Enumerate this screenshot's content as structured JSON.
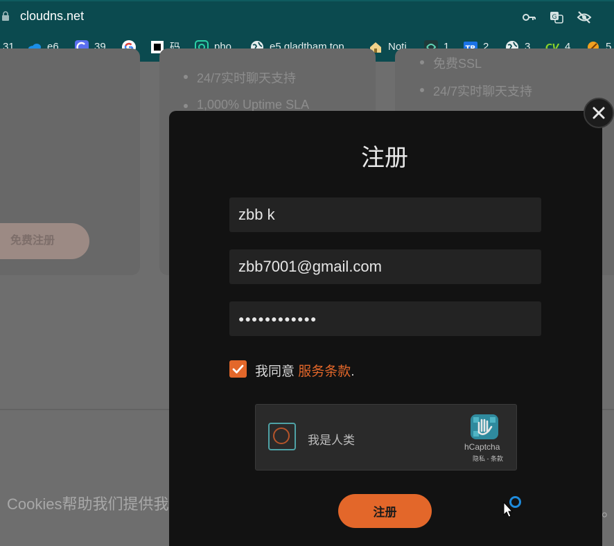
{
  "browser": {
    "url": "cloudns.net",
    "toolbar_icons": [
      "key-icon",
      "translate-icon",
      "eye-off-icon"
    ],
    "bookmarks": [
      {
        "label": "31",
        "icon": "calendar-icon"
      },
      {
        "label": "e6",
        "icon": "onedrive-icon"
      },
      {
        "label": "39",
        "icon": "c-logo-icon"
      },
      {
        "label": "",
        "icon": "google-icon"
      },
      {
        "label": "码",
        "icon": "square-logo-icon"
      },
      {
        "label": "pho",
        "icon": "pho-logo-icon"
      },
      {
        "label": "e5.gladtbam.top",
        "icon": "globe-icon"
      },
      {
        "label": "Noti",
        "icon": "notion-home-icon"
      },
      {
        "label": "1",
        "icon": "app-logo-icon"
      },
      {
        "label": "2",
        "icon": "tp-logo-icon"
      },
      {
        "label": "3",
        "icon": "globe-icon"
      },
      {
        "label": "4",
        "icon": "cv-logo-icon"
      },
      {
        "label": "5",
        "icon": "orange-circle-icon"
      }
    ],
    "bookmark_tp": "TP",
    "bookmark_cv": "CV"
  },
  "background": {
    "features_left": [
      "24/7实时聊天支持",
      "1,000% Uptime SLA"
    ],
    "features_right": [
      "免费SSL",
      "24/7实时聊天支持"
    ],
    "free_signup_button": "免费注册",
    "cookie_text": "Cookies帮助我们提供我",
    "cookie_tail": "。"
  },
  "modal": {
    "title": "注册",
    "name_value": "zbb k",
    "email_value": "zbb7001@gmail.com",
    "password_value": "●●●●●●●●●●●●",
    "agree_text": "我同意 ",
    "terms_link": "服务条款",
    "terms_period": ".",
    "captcha": {
      "label": "我是人类",
      "brand": "hCaptcha",
      "links": "隐私 - 条款"
    },
    "submit_label": "注册"
  },
  "colors": {
    "accent": "#e3672a",
    "chrome": "#0b4a4f",
    "modal_bg": "#121212"
  }
}
